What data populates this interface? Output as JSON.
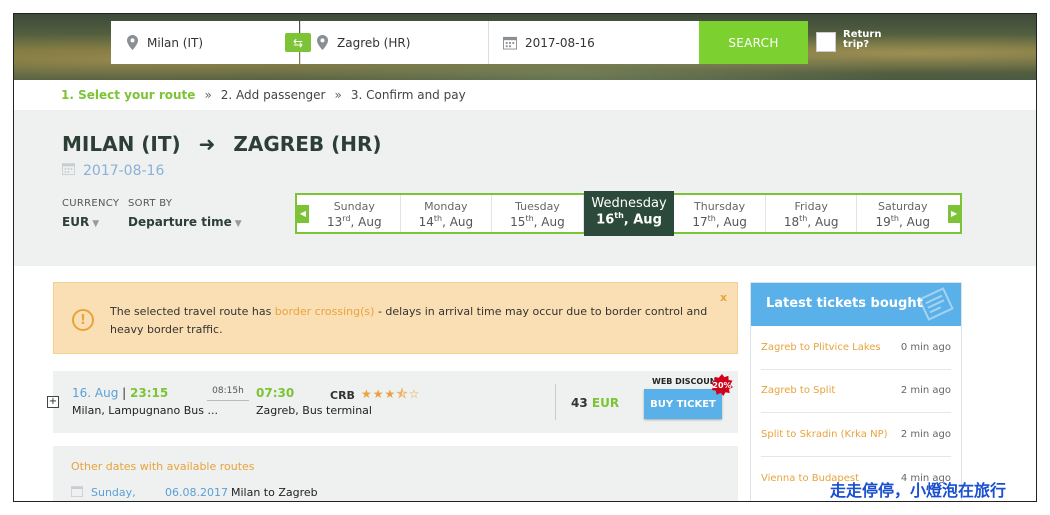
{
  "search": {
    "from": "Milan (IT)",
    "to": "Zagreb (HR)",
    "date": "2017-08-16",
    "search_label": "SEARCH",
    "return_label_1": "Return",
    "return_label_2": "trip?"
  },
  "steps": {
    "step1": "1. Select your route",
    "step2": "2. Add passenger",
    "step3": "3. Confirm and pay",
    "separator": "»"
  },
  "route": {
    "from": "MILAN (IT)",
    "to": "ZAGREB (HR)",
    "date": "2017-08-16"
  },
  "filters": {
    "currency_label": "CURRENCY",
    "currency_value": "EUR",
    "sort_label": "SORT BY",
    "sort_value": "Departure time"
  },
  "days": [
    {
      "name": "Sunday",
      "num": "13",
      "suffix": "rd",
      "month": "Aug"
    },
    {
      "name": "Monday",
      "num": "14",
      "suffix": "th",
      "month": "Aug"
    },
    {
      "name": "Tuesday",
      "num": "15",
      "suffix": "th",
      "month": "Aug"
    },
    {
      "name": "Wednesday",
      "num": "16",
      "suffix": "th",
      "month": "Aug"
    },
    {
      "name": "Thursday",
      "num": "17",
      "suffix": "th",
      "month": "Aug"
    },
    {
      "name": "Friday",
      "num": "18",
      "suffix": "th",
      "month": "Aug"
    },
    {
      "name": "Saturday",
      "num": "19",
      "suffix": "th",
      "month": "Aug"
    }
  ],
  "alert": {
    "text_before": "The selected travel route has ",
    "link": "border crossing(s)",
    "text_after": " - delays in arrival time may occur due to border control and heavy border traffic.",
    "close": "x"
  },
  "trip": {
    "dep_date": "16. Aug",
    "dep_sep": "|",
    "dep_time": "23:15",
    "from_station": "Milan, Lampugnano Bus ...",
    "duration": "08:15h",
    "arr_time": "07:30",
    "to_station": "Zagreb, Bus terminal",
    "operator": "CRB",
    "rating": 3.5,
    "price": "43",
    "currency": "EUR",
    "web_discount": "WEB DISCOUNT",
    "discount": "20%",
    "buy_label": "BUY TICKET"
  },
  "other_dates": {
    "heading": "Other dates with available routes",
    "day": "Sunday,",
    "date": "06.08.2017",
    "route": "Milan to Zagreb"
  },
  "latest": {
    "title": "Latest tickets bought",
    "items": [
      {
        "route": "Zagreb to Plitvice Lakes",
        "ago": "0 min ago"
      },
      {
        "route": "Zagreb to Split",
        "ago": "2 min ago"
      },
      {
        "route": "Split to Skradin (Krka NP)",
        "ago": "2 min ago"
      },
      {
        "route": "Vienna to Budapest",
        "ago": "4 min ago"
      }
    ]
  },
  "watermark": "走走停停，小燈泡在旅行",
  "colors": {
    "accent_green": "#7cc435",
    "dark_green": "#2c4a3b",
    "blue": "#5ab0e8",
    "orange": "#e8a33c"
  }
}
